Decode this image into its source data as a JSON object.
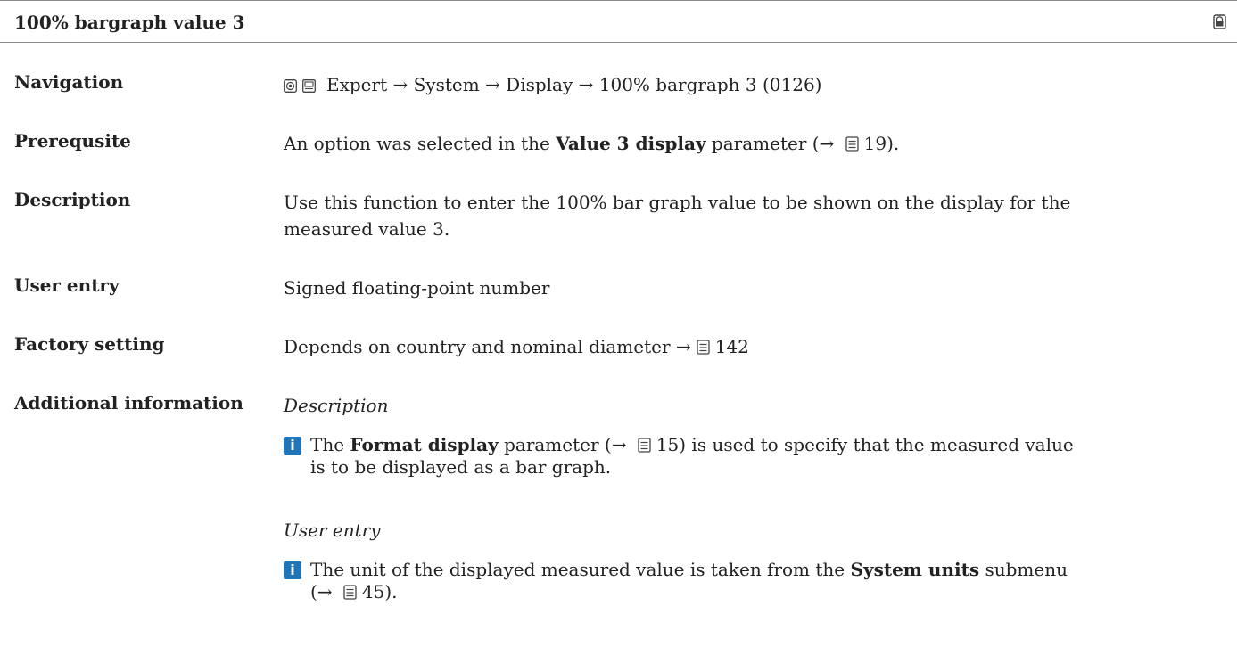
{
  "header": {
    "title": "100% bargraph value 3"
  },
  "rows": {
    "navigation": {
      "label": "Navigation",
      "path": "Expert → System → Display → 100% bargraph 3 (0126)"
    },
    "prerequisite": {
      "label": "Prerequsite",
      "pre": "An option was selected in the ",
      "param": "Value 3 display",
      "post": " parameter (→ ",
      "ref": "19",
      "end": ")."
    },
    "description": {
      "label": "Description",
      "line1": "Use this function to enter the 100% bar graph value to be shown on the display for the",
      "line2": "measured value 3."
    },
    "user_entry": {
      "label": "User entry",
      "value": "Signed floating-point number"
    },
    "factory_setting": {
      "label": "Factory setting",
      "text": "Depends on country and nominal diameter →",
      "ref": "142"
    },
    "additional_info": {
      "label": "Additional information",
      "section1_title": "Description",
      "note1_pre": "The ",
      "note1_param": "Format display",
      "note1_mid": " parameter (→ ",
      "note1_ref": "15",
      "note1_post": ") is used to specify that the measured value",
      "note1_line2": "is to be displayed as a bar graph.",
      "section2_title": "User entry",
      "note2_pre": "The unit of the displayed measured value is taken from the ",
      "note2_param": "System units",
      "note2_post": " submenu",
      "note2_line2_pre": "(→ ",
      "note2_ref": "45",
      "note2_line2_post": ")."
    }
  },
  "icons": {
    "lock": "lock-icon",
    "book": "book-icon",
    "info": "info-icon",
    "info_glyph": "i"
  }
}
